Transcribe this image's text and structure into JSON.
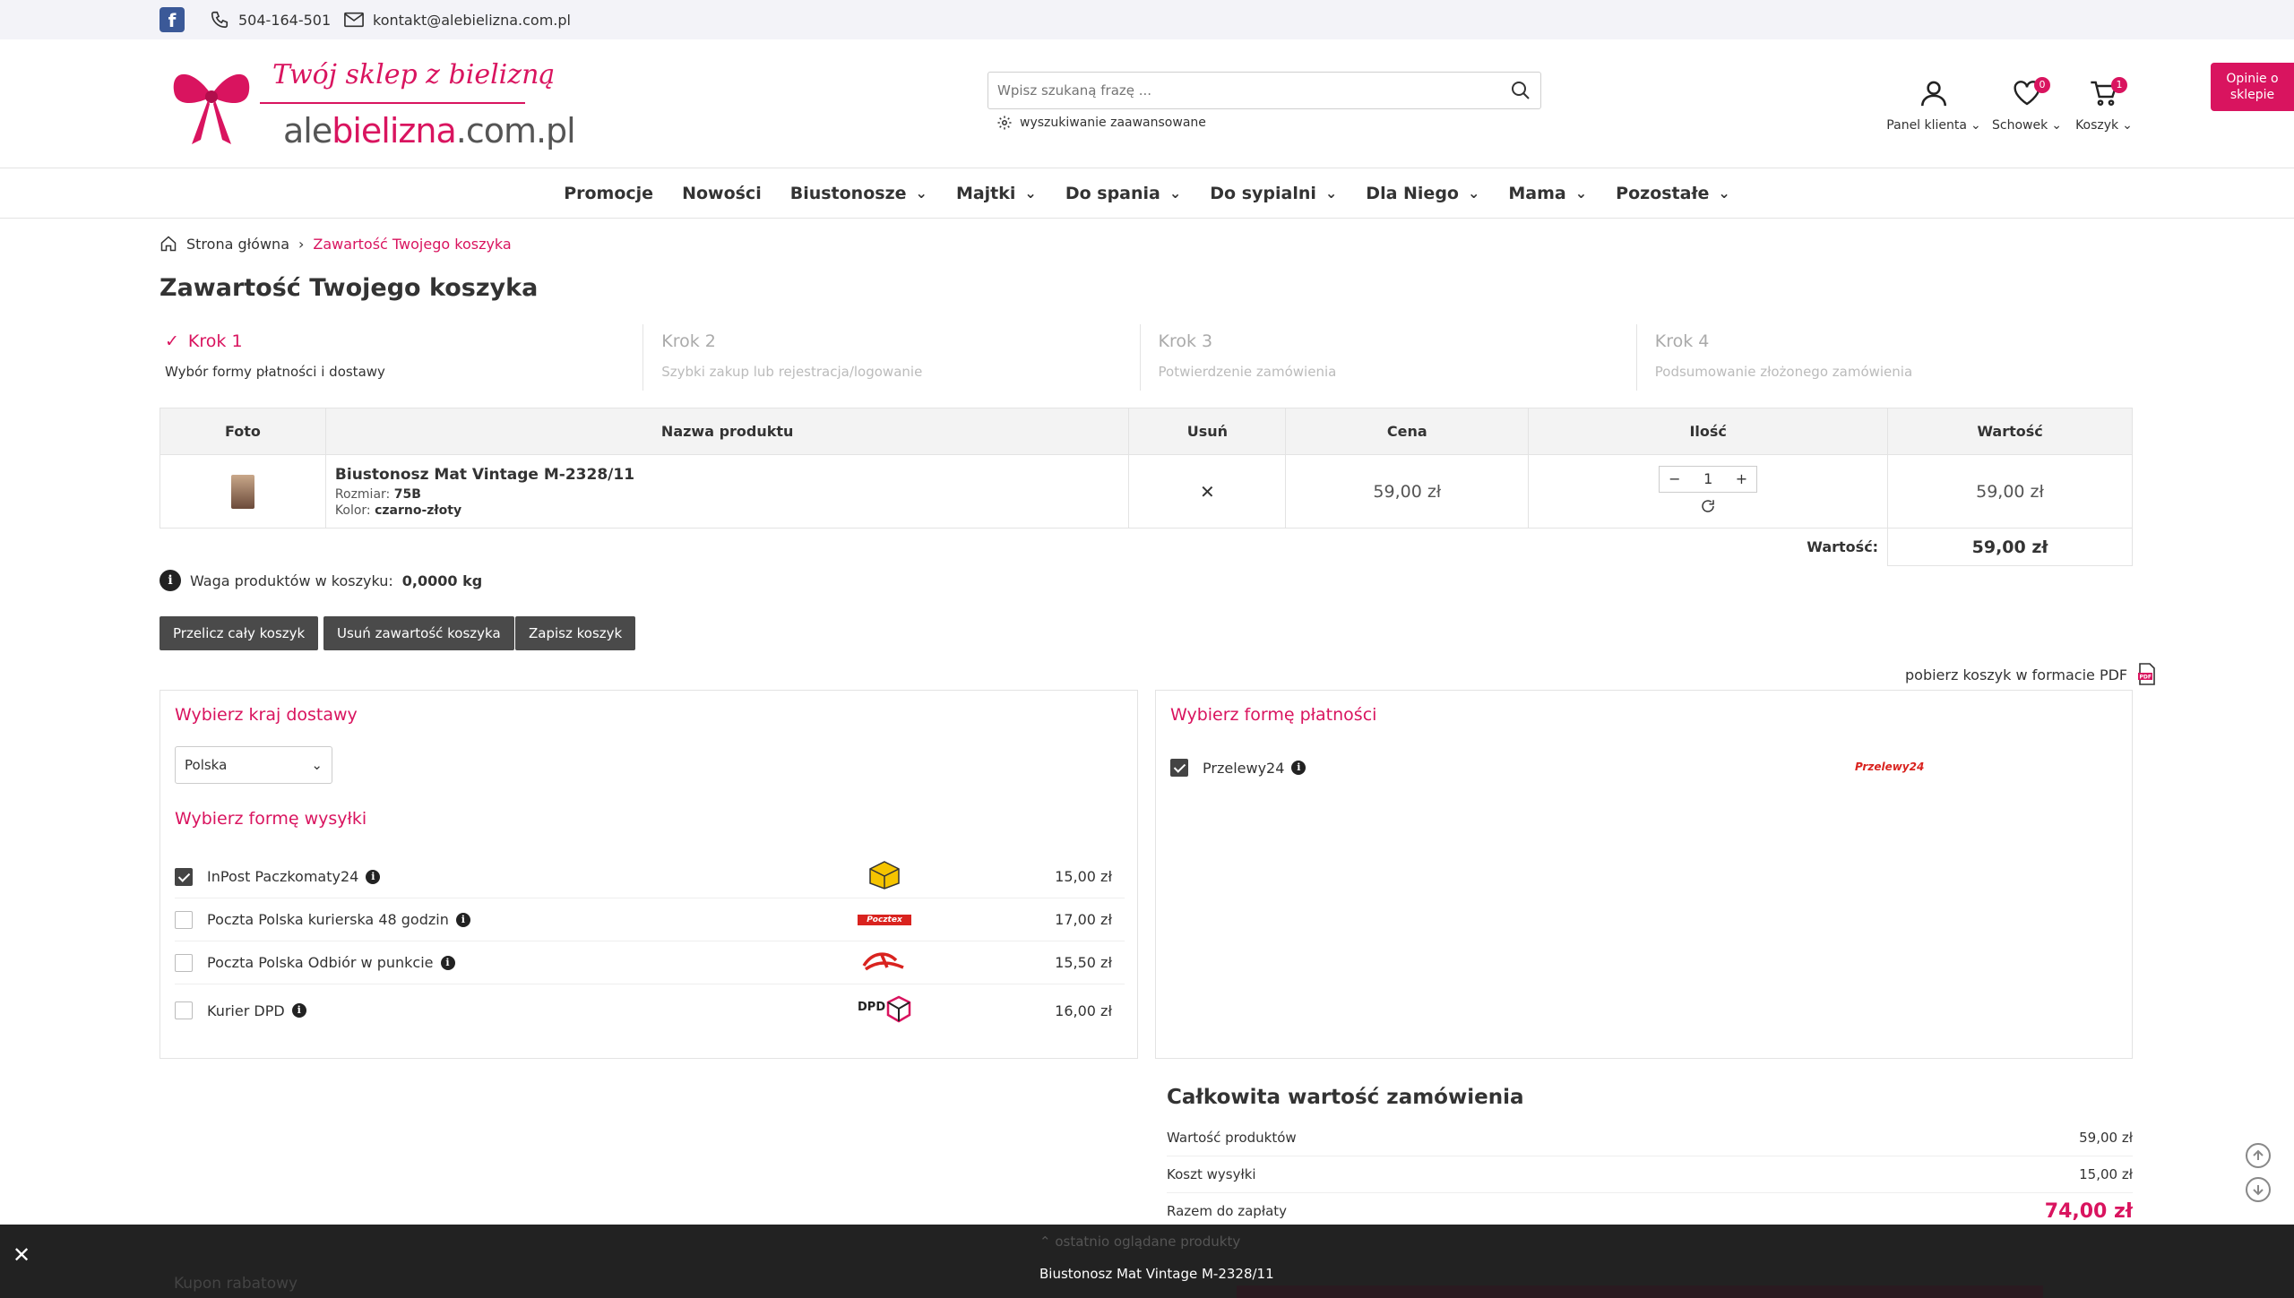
{
  "topbar": {
    "phone": "504-164-501",
    "email": "kontakt@alebielizna.com.pl"
  },
  "logo": {
    "script": "Twój sklep z bielizną",
    "main_a": "ale",
    "main_b": "bielizna",
    "main_c": ".com.pl"
  },
  "search": {
    "placeholder": "Wpisz szukaną frazę ...",
    "advanced": "wyszukiwanie zaawansowane"
  },
  "header_icons": [
    {
      "label": "Panel klienta",
      "badge": ""
    },
    {
      "label": "Schowek",
      "badge": "0"
    },
    {
      "label": "Koszyk",
      "badge": "1"
    }
  ],
  "opinie": {
    "line1": "Opinie o",
    "line2": "sklepie"
  },
  "nav": [
    {
      "label": "Promocje",
      "dropdown": false
    },
    {
      "label": "Nowości",
      "dropdown": false
    },
    {
      "label": "Biustonosze",
      "dropdown": true
    },
    {
      "label": "Majtki",
      "dropdown": true
    },
    {
      "label": "Do spania",
      "dropdown": true
    },
    {
      "label": "Do sypialni",
      "dropdown": true
    },
    {
      "label": "Dla Niego",
      "dropdown": true
    },
    {
      "label": "Mama",
      "dropdown": true
    },
    {
      "label": "Pozostałe",
      "dropdown": true
    }
  ],
  "breadcrumb": {
    "home": "Strona główna",
    "current": "Zawartość Twojego koszyka"
  },
  "page_title": "Zawartość Twojego koszyka",
  "steps": [
    {
      "title": "Krok 1",
      "desc": "Wybór formy płatności i dostawy"
    },
    {
      "title": "Krok 2",
      "desc": "Szybki zakup lub rejestracja/logowanie"
    },
    {
      "title": "Krok 3",
      "desc": "Potwierdzenie zamówienia"
    },
    {
      "title": "Krok 4",
      "desc": "Podsumowanie złożonego zamówienia"
    }
  ],
  "cart_table": {
    "headers": [
      "Foto",
      "Nazwa produktu",
      "Usuń",
      "Cena",
      "Ilość",
      "Wartość"
    ],
    "item": {
      "name": "Biustonosz Mat Vintage M-2328/11",
      "size_label": "Rozmiar:",
      "size": "75B",
      "color_label": "Kolor:",
      "color": "czarno-złoty",
      "price": "59,00 zł",
      "qty": "1",
      "value": "59,00 zł"
    },
    "total_label": "Wartość:",
    "total_value": "59,00 zł"
  },
  "weight": {
    "label": "Waga produktów w koszyku:",
    "value": "0,0000 kg"
  },
  "buttons": {
    "recalc": "Przelicz cały koszyk",
    "clear": "Usuń zawartość koszyka",
    "save": "Zapisz koszyk"
  },
  "pdf_link": "pobierz koszyk w formacie PDF",
  "delivery": {
    "country_title": "Wybierz kraj dostawy",
    "country": "Polska",
    "shipping_title": "Wybierz formę wysyłki",
    "options": [
      {
        "name": "InPost Paczkomaty24",
        "price": "15,00 zł",
        "checked": true,
        "logo": "inpost-logo"
      },
      {
        "name": "Poczta Polska kurierska 48 godzin",
        "price": "17,00 zł",
        "checked": false,
        "logo": "pocztex-logo"
      },
      {
        "name": "Poczta Polska Odbiór w punkcie",
        "price": "15,50 zł",
        "checked": false,
        "logo": "poczta-polska-logo"
      },
      {
        "name": "Kurier DPD",
        "price": "16,00 zł",
        "checked": false,
        "logo": "dpd-logo"
      }
    ]
  },
  "payment": {
    "title": "Wybierz formę płatności",
    "option": "Przelewy24",
    "logo_text": "Przelewy24"
  },
  "summary": {
    "title": "Całkowita wartość zamówienia",
    "rows": [
      {
        "label": "Wartość produktów",
        "value": "59,00 zł"
      },
      {
        "label": "Koszt wysyłki",
        "value": "15,00 zł"
      },
      {
        "label": "Razem do zapłaty",
        "value": "74,00 zł"
      }
    ]
  },
  "bottom_bar": {
    "recent": "ostatnio oglądane produkty",
    "product": "Biustonosz Mat Vintage M-2328/11",
    "coupon": "Kupon rabatowy"
  },
  "colors": {
    "accent": "#d9145f",
    "dark_button": "#4a4a4a",
    "bottom_bar": "#222222"
  }
}
